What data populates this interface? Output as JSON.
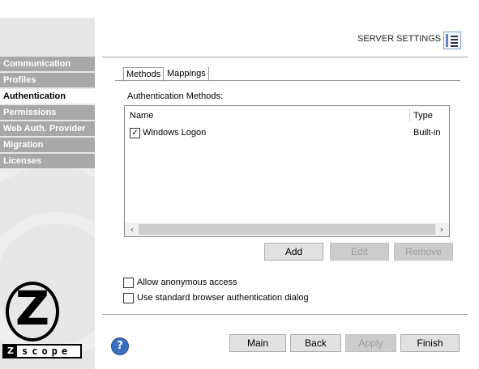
{
  "sidebar": {
    "items": [
      {
        "label": "Communication",
        "active": false
      },
      {
        "label": "Profiles",
        "active": false
      },
      {
        "label": "Authentication",
        "active": true
      },
      {
        "label": "Permissions",
        "active": false
      },
      {
        "label": "Web Auth. Provider",
        "active": false
      },
      {
        "label": "Migration",
        "active": false
      },
      {
        "label": "Licenses",
        "active": false
      }
    ],
    "logo": {
      "letter": "Z",
      "z_box": "Z",
      "word": "scope"
    }
  },
  "header": {
    "title": "SERVER SETTINGS",
    "icon": "server-settings-icon"
  },
  "tabs": [
    {
      "label": "Methods",
      "active": true
    },
    {
      "label": "Mappings",
      "active": false
    }
  ],
  "methods": {
    "section_label": "Authentication Methods:",
    "columns": [
      "Name",
      "Type"
    ],
    "rows": [
      {
        "checked": true,
        "name": "Windows Logon",
        "type": "Built-in"
      }
    ],
    "buttons": {
      "add": "Add",
      "edit": "Edit",
      "remove": "Remove"
    }
  },
  "options": {
    "anonymous": {
      "label": "Allow anonymous access",
      "checked": false
    },
    "browser_dialog": {
      "label": "Use standard browser authentication dialog",
      "checked": false
    }
  },
  "footer": {
    "help_icon": "help-icon",
    "buttons": {
      "main": "Main",
      "back": "Back",
      "apply": "Apply",
      "finish": "Finish"
    }
  },
  "colors": {
    "accent": "#3a6fc2",
    "sidebar_item": "#a8a8a8",
    "sidebar_bg": "#e7e7e7"
  }
}
